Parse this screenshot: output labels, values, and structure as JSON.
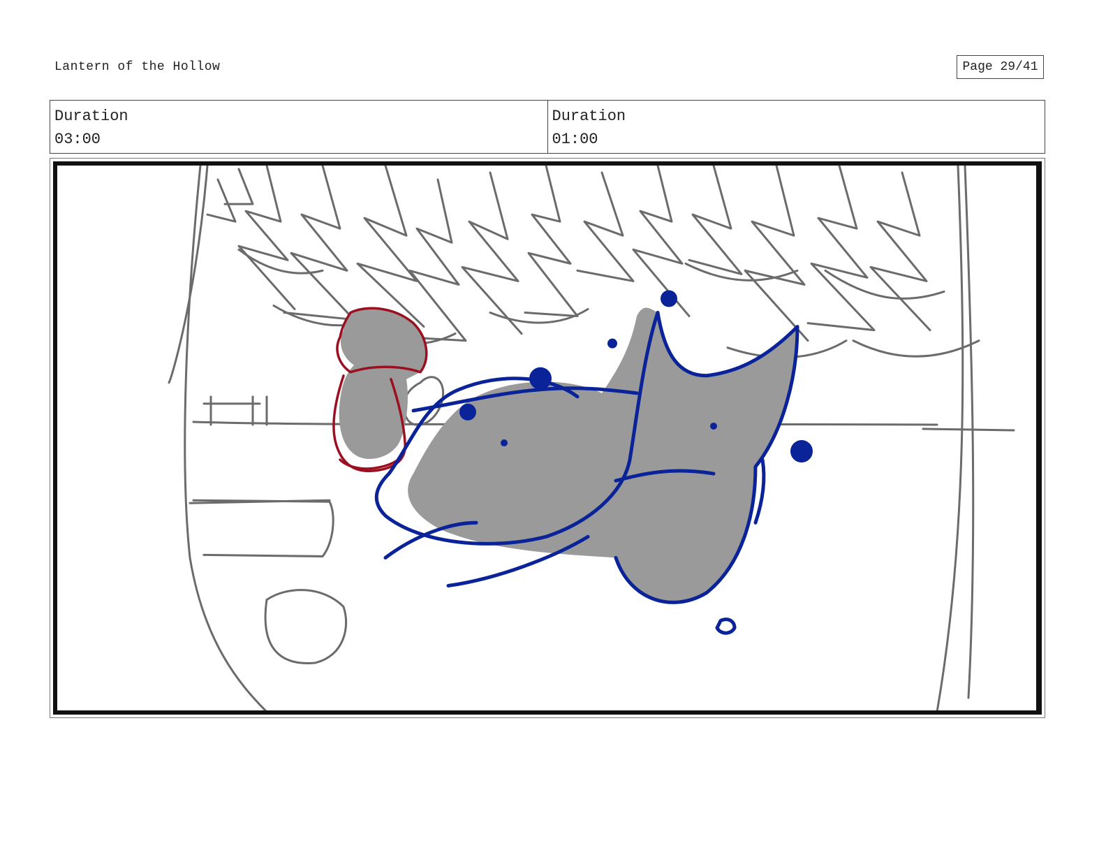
{
  "header": {
    "project_title": "Lantern of the Hollow",
    "page_label": "Page 29/41"
  },
  "durations": [
    {
      "label": "Duration",
      "value": "03:00"
    },
    {
      "label": "Duration",
      "value": "01:00"
    }
  ],
  "panel": {
    "colors": {
      "background_lines": "#6b6b6b",
      "girl_outline": "#9b1020",
      "beast_outline": "#0a2399",
      "fill": "#9a9a9a",
      "frame": "#111111"
    }
  }
}
